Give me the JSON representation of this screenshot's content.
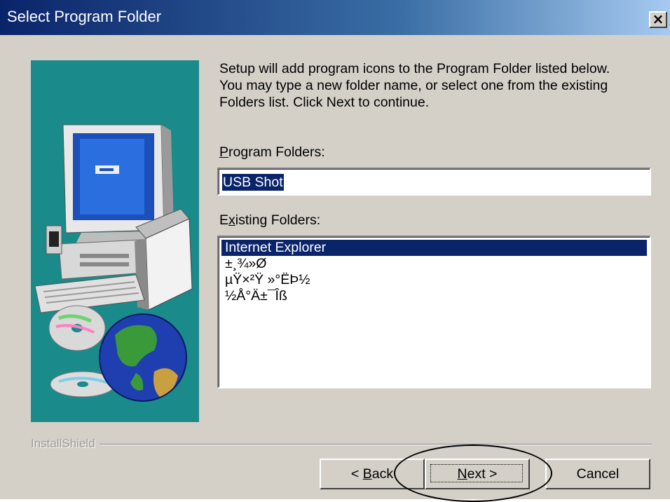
{
  "window": {
    "title": "Select Program Folder",
    "close_glyph": "×"
  },
  "info": {
    "text": "Setup will add program icons to the Program Folder listed below.\nYou may type a new folder name, or select one from the existing\nFolders list.  Click Next to continue."
  },
  "program_folders": {
    "label_mnemonic": "P",
    "label_rest": "rogram Folders:",
    "value": "USB Shot"
  },
  "existing_folders": {
    "label_first": "E",
    "label_mnemonic": "x",
    "label_rest": "isting Folders:",
    "items": [
      "Internet Explorer",
      "±¸¾»Ø",
      "µŸ×²Ÿ »°ËÞ½",
      "½Å°Ä±¯Îß"
    ],
    "selected_index": 0
  },
  "footer": {
    "brand": "InstallShield"
  },
  "buttons": {
    "back_prefix": "< ",
    "back_mnemonic": "B",
    "back_rest": "ack",
    "next_mnemonic": "N",
    "next_rest": "ext >",
    "cancel": "Cancel"
  },
  "colors": {
    "title_start": "#0a246a",
    "title_end": "#a6caf0",
    "face": "#d4d0c8",
    "selection": "#0a246a",
    "art_bg": "#1a8a8a"
  },
  "icons": [
    "close-icon",
    "computer-illustration",
    "cd-icon",
    "globe-icon"
  ]
}
